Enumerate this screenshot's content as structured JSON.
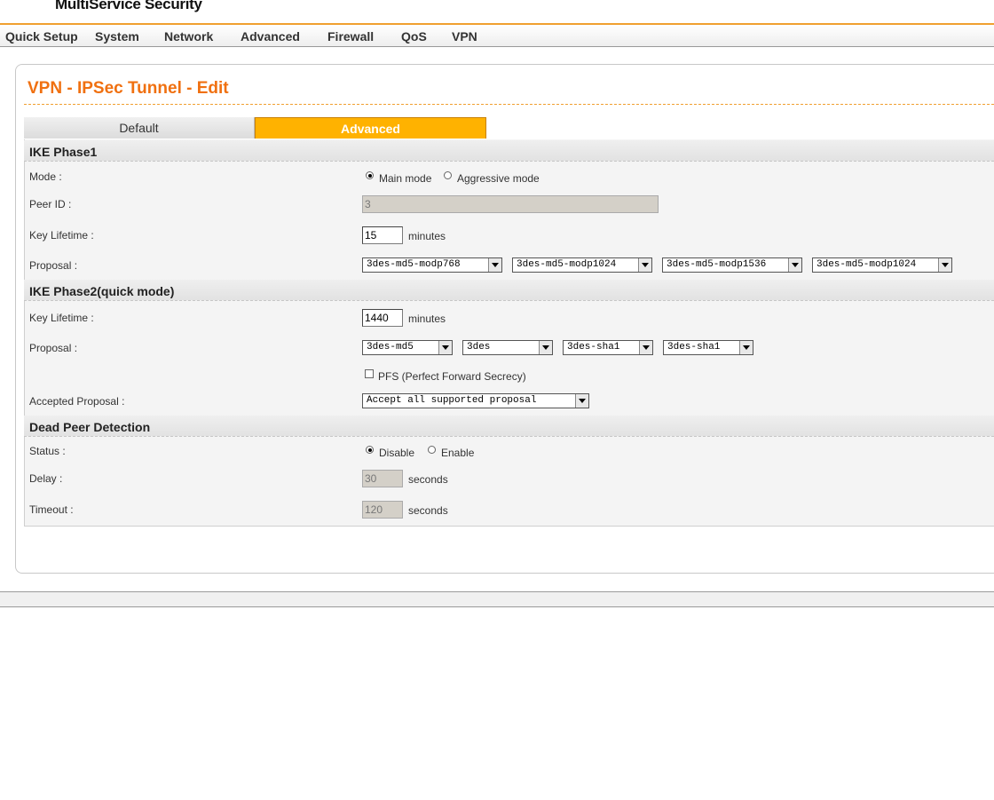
{
  "brand": "MultiService Security",
  "menu": [
    "Quick Setup",
    "System",
    "Network",
    "Advanced",
    "Firewall",
    "QoS",
    "VPN"
  ],
  "page_title": "VPN - IPSec Tunnel - Edit",
  "tabs": {
    "default": "Default",
    "advanced": "Advanced",
    "active": "Advanced"
  },
  "ike_phase1": {
    "title": "IKE Phase1",
    "mode_label": "Mode :",
    "mode_main": "Main mode",
    "mode_aggressive": "Aggressive mode",
    "mode_selected": "Main mode",
    "peer_id_label": "Peer ID :",
    "peer_id_value": "3",
    "key_lifetime_label": "Key Lifetime :",
    "key_lifetime_value": "15",
    "key_lifetime_unit": "minutes",
    "proposal_label": "Proposal :",
    "proposals": [
      "3des-md5-modp768",
      "3des-md5-modp1024",
      "3des-md5-modp1536",
      "3des-md5-modp1024"
    ]
  },
  "ike_phase2": {
    "title": "IKE Phase2(quick mode)",
    "key_lifetime_label": "Key Lifetime :",
    "key_lifetime_value": "1440",
    "key_lifetime_unit": "minutes",
    "proposal_label": "Proposal :",
    "proposals": [
      "3des-md5",
      "3des",
      "3des-sha1",
      "3des-sha1"
    ],
    "pfs_label": "PFS (Perfect Forward Secrecy)",
    "pfs_checked": false,
    "accepted_label": "Accepted Proposal :",
    "accepted_value": "Accept all supported proposal"
  },
  "dpd": {
    "title": "Dead Peer Detection",
    "status_label": "Status :",
    "status_disable": "Disable",
    "status_enable": "Enable",
    "status_selected": "Disable",
    "delay_label": "Delay :",
    "delay_value": "30",
    "delay_unit": "seconds",
    "timeout_label": "Timeout :",
    "timeout_value": "120",
    "timeout_unit": "seconds"
  }
}
